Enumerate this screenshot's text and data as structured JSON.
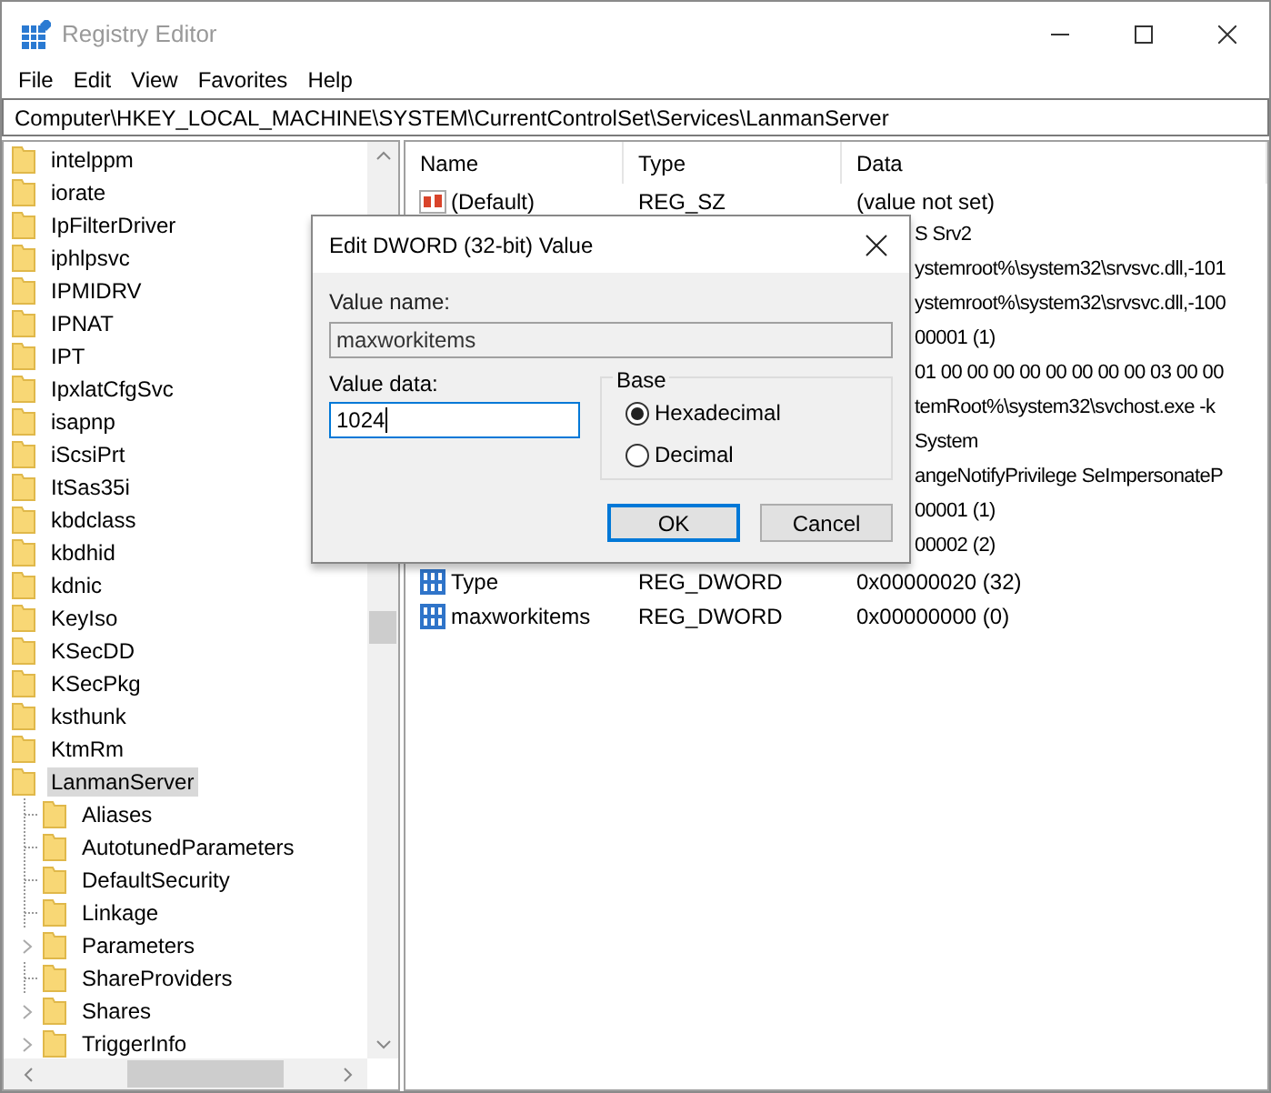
{
  "window": {
    "title": "Registry Editor"
  },
  "menu": [
    "File",
    "Edit",
    "View",
    "Favorites",
    "Help"
  ],
  "address": "Computer\\HKEY_LOCAL_MACHINE\\SYSTEM\\CurrentControlSet\\Services\\LanmanServer",
  "tree": [
    {
      "label": "intelppm",
      "selected": false
    },
    {
      "label": "iorate",
      "selected": false
    },
    {
      "label": "IpFilterDriver",
      "selected": false
    },
    {
      "label": "iphlpsvc",
      "selected": false
    },
    {
      "label": "IPMIDRV",
      "selected": false
    },
    {
      "label": "IPNAT",
      "selected": false
    },
    {
      "label": "IPT",
      "selected": false
    },
    {
      "label": "IpxlatCfgSvc",
      "selected": false
    },
    {
      "label": "isapnp",
      "selected": false
    },
    {
      "label": "iScsiPrt",
      "selected": false
    },
    {
      "label": "ItSas35i",
      "selected": false
    },
    {
      "label": "kbdclass",
      "selected": false
    },
    {
      "label": "kbdhid",
      "selected": false
    },
    {
      "label": "kdnic",
      "selected": false
    },
    {
      "label": "KeyIso",
      "selected": false
    },
    {
      "label": "KSecDD",
      "selected": false
    },
    {
      "label": "KSecPkg",
      "selected": false
    },
    {
      "label": "ksthunk",
      "selected": false
    },
    {
      "label": "KtmRm",
      "selected": false
    },
    {
      "label": "LanmanServer",
      "selected": true,
      "children": [
        {
          "label": "Aliases",
          "expandable": false
        },
        {
          "label": "AutotunedParameters",
          "expandable": false
        },
        {
          "label": "DefaultSecurity",
          "expandable": false
        },
        {
          "label": "Linkage",
          "expandable": false
        },
        {
          "label": "Parameters",
          "expandable": true
        },
        {
          "label": "ShareProviders",
          "expandable": false
        },
        {
          "label": "Shares",
          "expandable": true
        },
        {
          "label": "TriggerInfo",
          "expandable": true
        }
      ]
    }
  ],
  "table": {
    "columns": [
      "Name",
      "Type",
      "Data"
    ],
    "rows": [
      {
        "kind": "string",
        "name": "(Default)",
        "type": "REG_SZ",
        "data": "(value not set)"
      },
      {
        "data": "S Srv2"
      },
      {
        "data": "ystemroot%\\system32\\srvsvc.dll,-101"
      },
      {
        "data": "ystemroot%\\system32\\srvsvc.dll,-100"
      },
      {
        "data": "00001 (1)"
      },
      {
        "data": "01 00 00 00 00 00 00 00 00 03 00 00"
      },
      {
        "data": "temRoot%\\system32\\svchost.exe -k"
      },
      {
        "data": "System"
      },
      {
        "data": "angeNotifyPrivilege SeImpersonateP"
      },
      {
        "data": "00001 (1)"
      },
      {
        "data": "00002 (2)"
      },
      {
        "kind": "binary",
        "name": "Type",
        "type": "REG_DWORD",
        "data": "0x00000020 (32)"
      },
      {
        "kind": "binary",
        "name": "maxworkitems",
        "type": "REG_DWORD",
        "data": "0x00000000 (0)"
      }
    ]
  },
  "dialog": {
    "title": "Edit DWORD (32-bit) Value",
    "value_name_label": "Value name:",
    "value_name": "maxworkitems",
    "value_data_label": "Value data:",
    "value_data": "1024",
    "base_label": "Base",
    "base_options": [
      {
        "label": "Hexadecimal",
        "selected": true
      },
      {
        "label": "Decimal",
        "selected": false
      }
    ],
    "buttons": [
      {
        "label": "OK",
        "default": true
      },
      {
        "label": "Cancel",
        "default": false
      }
    ]
  }
}
